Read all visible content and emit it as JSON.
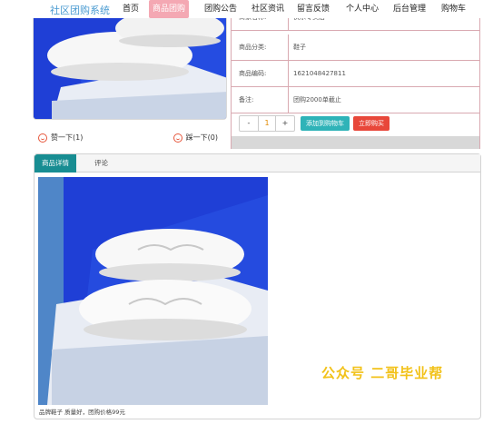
{
  "nav": {
    "brand": "社区团购系统",
    "items": [
      {
        "label": "首页",
        "active": false
      },
      {
        "label": "商品团购",
        "active": true
      },
      {
        "label": "团购公告",
        "active": false
      },
      {
        "label": "社区资讯",
        "active": false
      },
      {
        "label": "留言反馈",
        "active": false
      },
      {
        "label": "个人中心",
        "active": false
      },
      {
        "label": "后台管理",
        "active": false
      },
      {
        "label": "购物车",
        "active": false
      }
    ]
  },
  "vote": {
    "like_label": "赞一下(1)",
    "dislike_label": "踩一下(0)"
  },
  "info": {
    "rows": [
      {
        "label": "商家名称:",
        "value": "快乐专卖店"
      },
      {
        "label": "商品分类:",
        "value": "鞋子"
      },
      {
        "label": "商品编码:",
        "value": "1621048427811"
      },
      {
        "label": "备注:",
        "value": "团购2000单截止"
      }
    ],
    "stepper_minus": "-",
    "quantity": "1",
    "stepper_plus": "+",
    "add_cart_label": "添加到购物车",
    "buy_label": "立即购买"
  },
  "tabs": {
    "items": [
      {
        "label": "商品详情",
        "active": true
      },
      {
        "label": "评论",
        "active": false
      }
    ]
  },
  "detail": {
    "caption": "品牌鞋子 质量好，团购价格99元"
  },
  "watermark": "公众号 二哥毕业帮",
  "colors": {
    "accent_teal": "#188d92",
    "nav_active": "#f4a8b3",
    "buy_red": "#e8473a",
    "cart_teal": "#2fb3b8",
    "product_bg": "#1f3fd6"
  }
}
